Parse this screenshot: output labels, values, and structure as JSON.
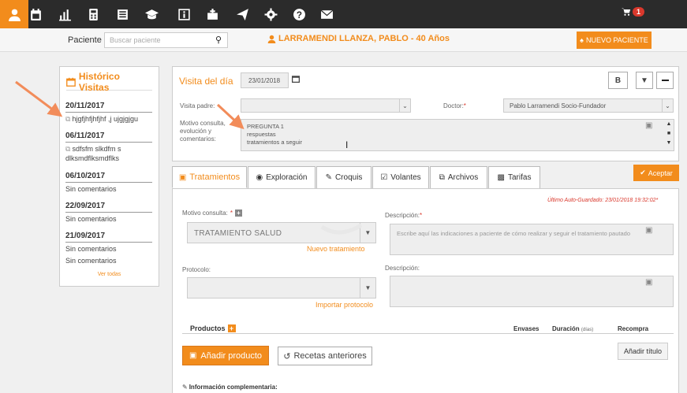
{
  "nav": {
    "icons": [
      "user-icon",
      "calendar-icon",
      "bar-chart-icon",
      "calculator-icon",
      "newspaper-icon",
      "graduation-cap-icon",
      "info-icon",
      "medkit-icon",
      "paper-plane-icon",
      "gear-icon",
      "question-icon",
      "envelope-icon"
    ],
    "cart_count": "1"
  },
  "patient": {
    "label": "Paciente",
    "search_placeholder": "Buscar paciente",
    "name": "LARRAMENDI LLANZA, PABLO - 40 Años",
    "new_button": "NUEVO PACIENTE"
  },
  "history": {
    "title": "Histórico Visitas",
    "visits": [
      {
        "date": "20/11/2017",
        "comment": "hjgfjhfjhfjhf ,j ujgjgjgu"
      },
      {
        "date": "06/11/2017",
        "comment": "sdfsfm slkdfm s",
        "comment2": "dlksmdflksmdflks"
      },
      {
        "date": "06/10/2017",
        "comment": "Sin comentarios"
      },
      {
        "date": "22/09/2017",
        "comment": "Sin comentarios"
      },
      {
        "date": "21/09/2017",
        "comment": "Sin comentarios",
        "comment2": "Sin comentarios"
      }
    ],
    "see_all": "Ver todas"
  },
  "visit": {
    "title": "Visita del día",
    "date": "23/01/2018",
    "bold_btn": "B",
    "parent_label": "Visita padre:",
    "doctor_label": "Doctor:",
    "doctor_value": "Pablo Larramendi Socio-Fundador",
    "motivo_label": "Motivo consulta, evolución y comentarios:",
    "motivo_lines": [
      "PREGUNTA 1",
      "respuestas",
      "tratamientos a seguir"
    ]
  },
  "tabs": [
    "Tratamientos",
    "Exploración",
    "Croquis",
    "Volantes",
    "Archivos",
    "Tarifas"
  ],
  "accept": "Aceptar",
  "autosave": "Último Auto-Guardado: 23/01/2018 19:32:02*",
  "treat": {
    "motivo_label": "Motivo consulta:",
    "motivo_value": "TRATAMIENTO SALUD",
    "new_treatment": "Nuevo tratamiento",
    "desc_label": "Descripción:",
    "desc_placeholder": "Escribe aquí las indicaciones a paciente de cómo realizar y seguir el tratamiento pautado",
    "protocol_label": "Protocolo:",
    "import_protocol": "Importar protocolo",
    "desc2_label": "Descripción:"
  },
  "products": {
    "label": "Productos",
    "col_envases": "Envases",
    "col_duracion": "Duración",
    "col_duracion_unit": "(días)",
    "col_recompra": "Recompra",
    "add_product": "Añadir producto",
    "prev_recipes": "Recetas anteriores",
    "add_title": "Añadir título"
  },
  "info": {
    "label": "Información complementaria:"
  }
}
